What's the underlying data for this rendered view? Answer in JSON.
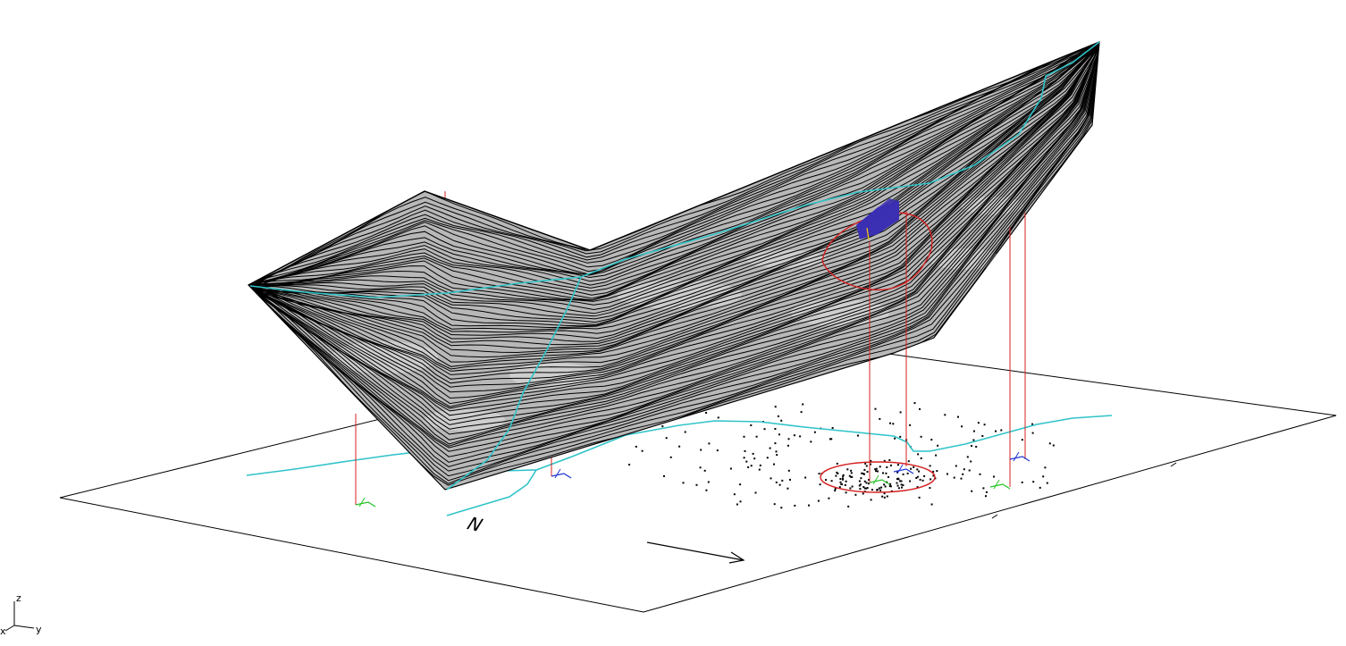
{
  "viewport": {
    "background": "#ffffff"
  },
  "colors": {
    "contour_line": "#000000",
    "surface_fill": "#b8b8b8",
    "surface_highlight": "#dcdcdc",
    "stream_line": "#2fc3c8",
    "vertical_marker": "#d42020",
    "boundary_circle": "#d42020",
    "building_box": "#3b2fb3",
    "survey_point": "#000000",
    "ground_frame": "#000000",
    "marker_blue": "#2036d0",
    "marker_green": "#24c424"
  },
  "axis_triad": {
    "z_label": "z",
    "y_label": "y",
    "x_label": "x"
  },
  "north_arrow": {
    "label": "N",
    "icon": "north-arrow-icon"
  },
  "elements": {
    "surface": "terrain-surface-contours",
    "ground_plane": "ground-plane-frame",
    "stream": "stream-polyline",
    "building": "building-box",
    "circle_upper": "site-boundary-circle-upper",
    "circle_lower": "site-boundary-circle-lower",
    "markers": "vertical-marker-lines",
    "points": "survey-point-cloud"
  }
}
